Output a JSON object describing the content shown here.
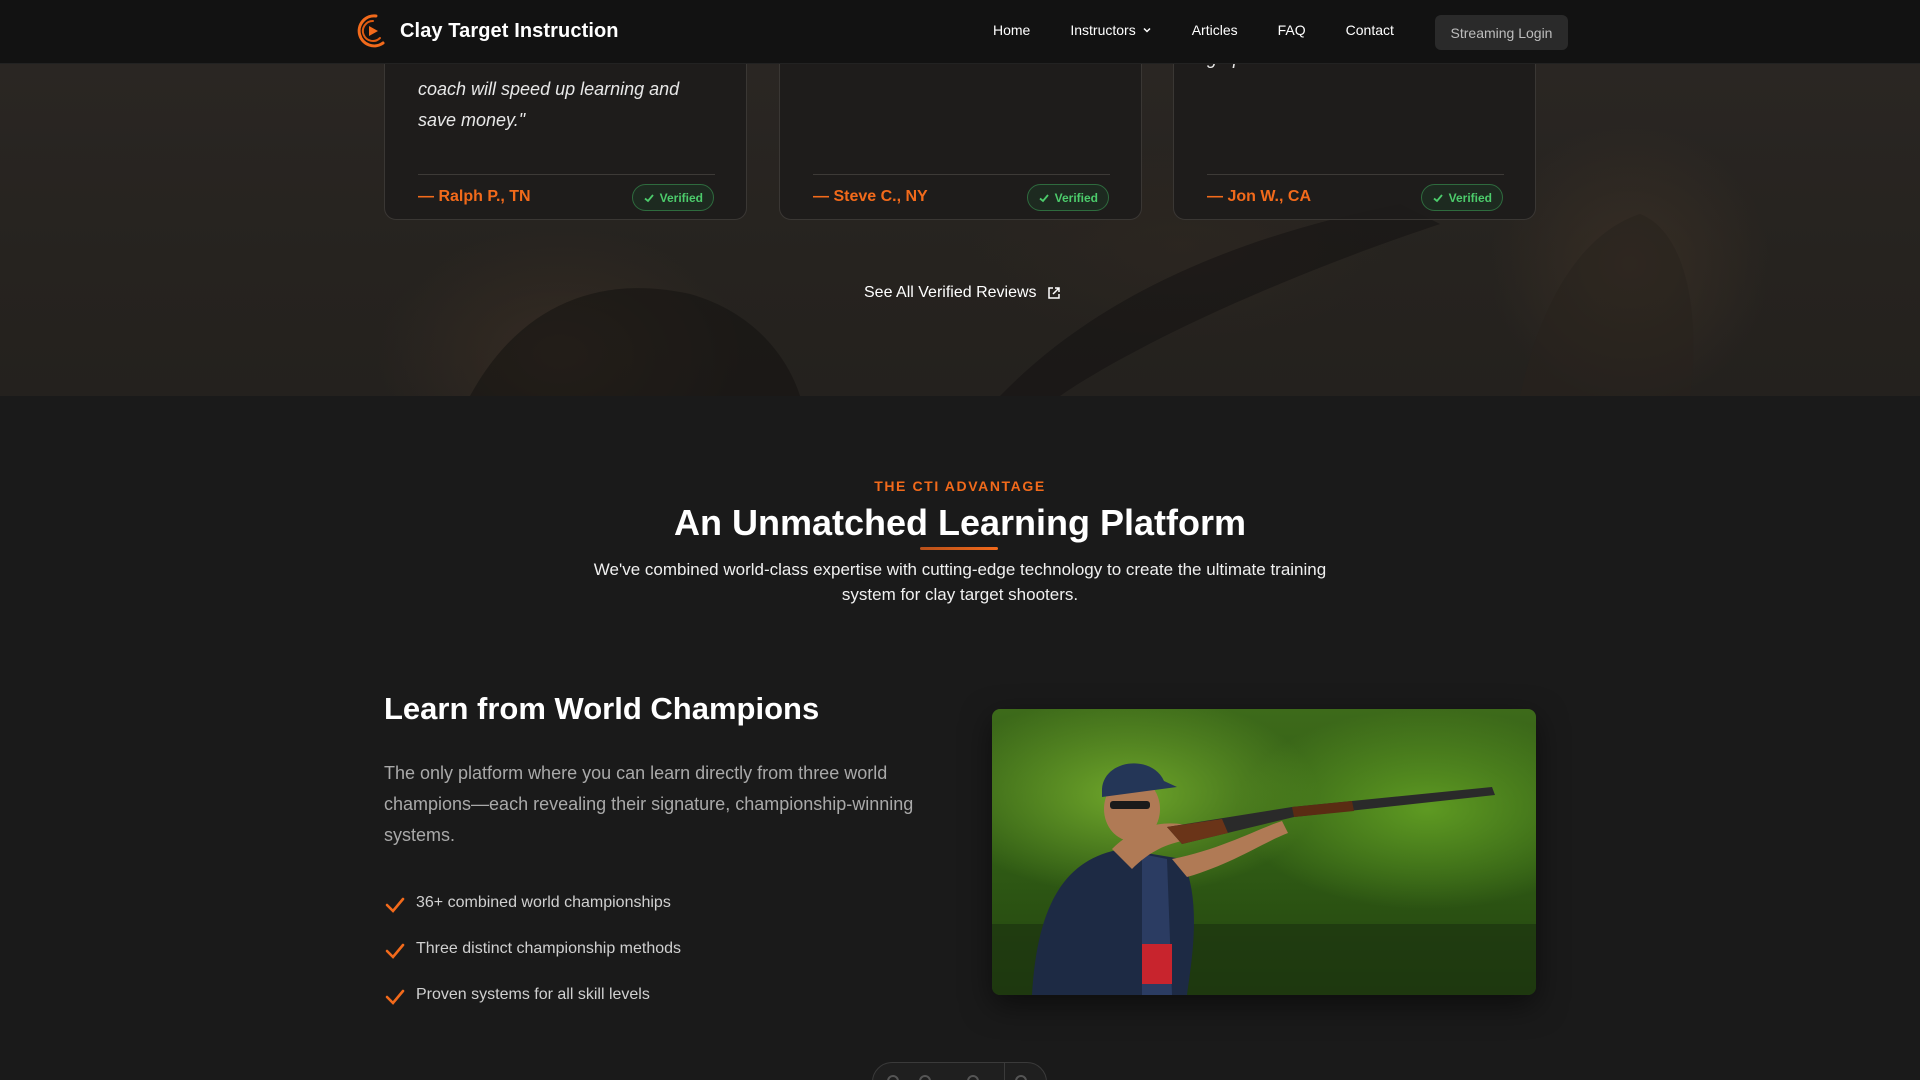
{
  "nav": {
    "brand": "Clay Target Instruction",
    "links": [
      "Home",
      "Instructors",
      "Articles",
      "FAQ",
      "Contact"
    ],
    "login": "Streaming Login"
  },
  "testimonials": [
    {
      "quote": "coach will speed up learning and save money.\"",
      "author": "— Ralph P., TN",
      "badge": "Verified"
    },
    {
      "quote": "",
      "author": "— Steve C., NY",
      "badge": "Verified"
    },
    {
      "quote": "graphics/overhead shots are cool!",
      "author": "— Jon W., CA",
      "badge": "Verified"
    }
  ],
  "see_all": "See All Verified Reviews",
  "advantage": {
    "eyebrow": "THE CTI ADVANTAGE",
    "title": "An Unmatched Learning Platform",
    "lead": "We've combined world-class expertise with cutting-edge technology to create the ultimate training system for clay target shooters."
  },
  "champions": {
    "title": "Learn from World Champions",
    "text": "The only platform where you can learn directly from three world champions—each revealing their signature, championship-winning systems.",
    "features": [
      "36+ combined world championships",
      "Three distinct championship methods",
      "Proven systems for all skill levels"
    ]
  },
  "colors": {
    "accent": "#f26a1b",
    "verified": "#4ccb6b",
    "background": "#1a1a1a"
  },
  "icons": {
    "brand": "play-logo-icon",
    "verified": "check-icon",
    "external": "external-link-icon",
    "feature": "checkmark-icon"
  }
}
